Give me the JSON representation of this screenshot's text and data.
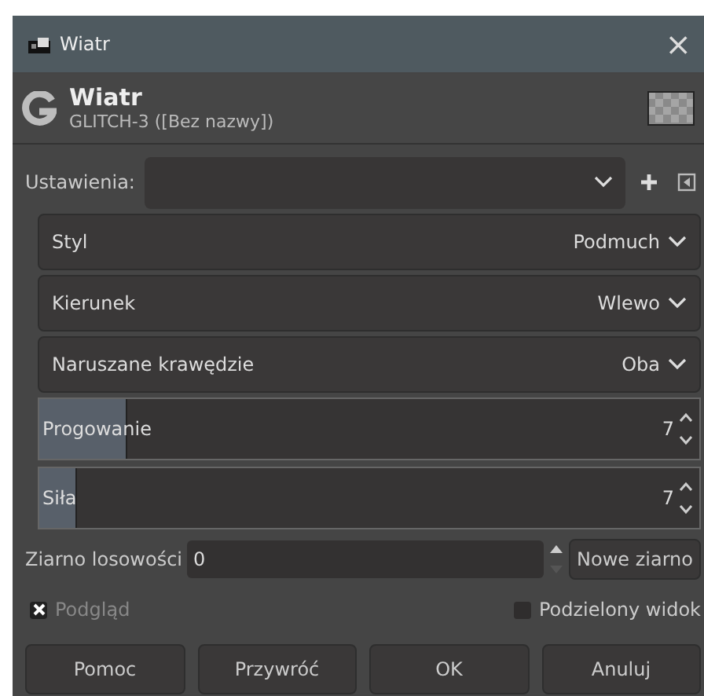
{
  "window": {
    "title": "Wiatr",
    "close": "×"
  },
  "header": {
    "title": "Wiatr",
    "subtitle": "GLITCH-3 ([Bez nazwy])"
  },
  "presets": {
    "label": "Ustawienia:"
  },
  "combos": [
    {
      "label": "Styl",
      "value": "Podmuch"
    },
    {
      "label": "Kierunek",
      "value": "Wlewo"
    },
    {
      "label": "Naruszane krawędzie",
      "value": "Oba"
    }
  ],
  "sliders": [
    {
      "label": "Progowanie",
      "value": "7",
      "level": 0.13
    },
    {
      "label": "Siła",
      "value": "7",
      "level": 0.055
    }
  ],
  "seed": {
    "label": "Ziarno losowości",
    "value": "0",
    "button": "Nowe ziarno"
  },
  "options": [
    {
      "label": "Podgląd",
      "checked": true
    },
    {
      "label": "Podzielony widok",
      "checked": false
    }
  ],
  "buttons": [
    "Pomoc",
    "Przywróć",
    "OK",
    "Anuluj"
  ]
}
